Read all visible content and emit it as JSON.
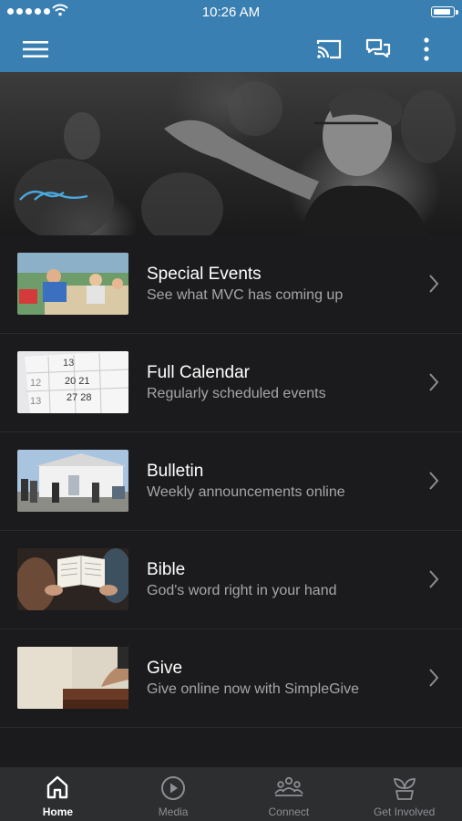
{
  "status_bar": {
    "time": "10:26 AM"
  },
  "hero": {},
  "menu_items": [
    {
      "title": "Special Events",
      "subtitle": "See what MVC has coming up",
      "thumb": "events-photo"
    },
    {
      "title": "Full Calendar",
      "subtitle": "Regularly scheduled events",
      "thumb": "calendar-photo"
    },
    {
      "title": "Bulletin",
      "subtitle": "Weekly announcements online",
      "thumb": "church-photo"
    },
    {
      "title": "Bible",
      "subtitle": "God's word right in your hand",
      "thumb": "bible-photo"
    },
    {
      "title": "Give",
      "subtitle": "Give online now with SimpleGive",
      "thumb": "give-photo"
    }
  ],
  "tabs": [
    {
      "label": "Home",
      "icon": "home-icon",
      "active": true
    },
    {
      "label": "Media",
      "icon": "play-circle-icon",
      "active": false
    },
    {
      "label": "Connect",
      "icon": "people-icon",
      "active": false
    },
    {
      "label": "Get Involved",
      "icon": "sprout-icon",
      "active": false
    }
  ],
  "colors": {
    "accent": "#3a7fb1",
    "background": "#1b1b1d",
    "tab_bar": "#2d2e30",
    "subtitle": "#a6a6aa",
    "tab_inactive": "#8e8e92"
  }
}
